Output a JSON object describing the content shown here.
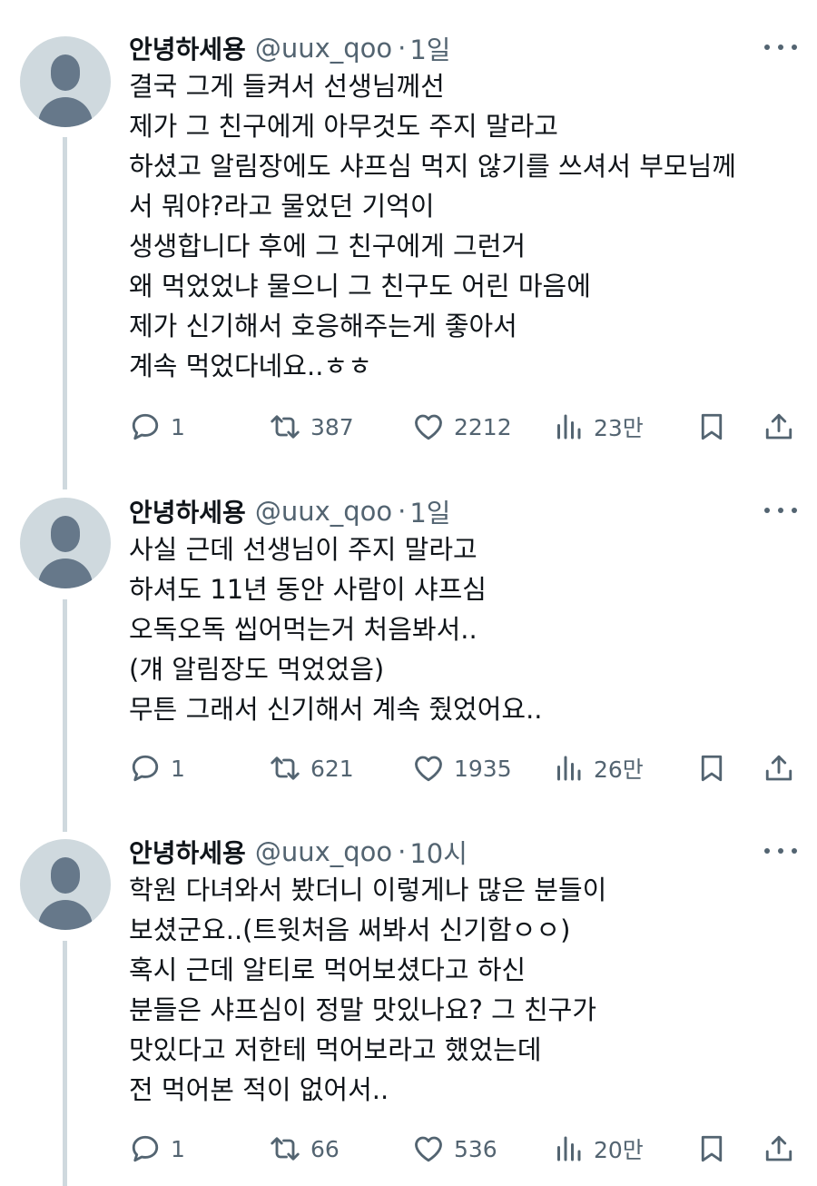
{
  "tweets": [
    {
      "name": "안녕하세용",
      "handle": "@uux_qoo",
      "dot": "·",
      "time": "1일",
      "lines": [
        "결국 그게 들켜서 선생님께선",
        "제가 그 친구에게 아무것도 주지 말라고",
        "하셨고 알림장에도 샤프심 먹지 않기를 쓰셔서 부모님께",
        "서 뭐야?라고 물었던 기억이",
        "생생합니다 후에 그 친구에게 그런거",
        "왜 먹었었냐 물으니 그 친구도 어린 마음에",
        "제가 신기해서 호응해주는게 좋아서",
        "계속 먹었다네요..ㅎㅎ"
      ],
      "replies": "1",
      "retweets": "387",
      "likes": "2212",
      "views": "23만"
    },
    {
      "name": "안녕하세용",
      "handle": "@uux_qoo",
      "dot": "·",
      "time": "1일",
      "lines": [
        "사실 근데 선생님이 주지 말라고",
        "하셔도 11년 동안 사람이 샤프심",
        "오독오독 씹어먹는거 처음봐서..",
        "(걔 알림장도 먹었었음)",
        "무튼 그래서 신기해서 계속 줬었어요.."
      ],
      "replies": "1",
      "retweets": "621",
      "likes": "1935",
      "views": "26만"
    },
    {
      "name": "안녕하세용",
      "handle": "@uux_qoo",
      "dot": "·",
      "time": "10시",
      "lines": [
        "학원 다녀와서 봤더니 이렇게나 많은 분들이",
        "보셨군요..(트윗처음 써봐서 신기함ㅇㅇ)",
        "혹시 근데 알티로 먹어보셨다고 하신",
        "분들은 샤프심이 정말 맛있나요? 그 친구가",
        "맛있다고 저한테 먹어보라고 했었는데",
        "전 먹어본 적이 없어서.."
      ],
      "replies": "1",
      "retweets": "66",
      "likes": "536",
      "views": "20만"
    }
  ],
  "icons": {
    "reply": "reply-icon",
    "retweet": "retweet-icon",
    "like": "heart-icon",
    "views": "views-chart-icon",
    "bookmark": "bookmark-icon",
    "share": "share-icon",
    "more": "more-options-icon"
  },
  "colors": {
    "text": "#0f1419",
    "secondary": "#536471",
    "thread_line": "#cfd9de",
    "avatar_bg": "#cfd9de",
    "avatar_fg": "#66788a"
  }
}
